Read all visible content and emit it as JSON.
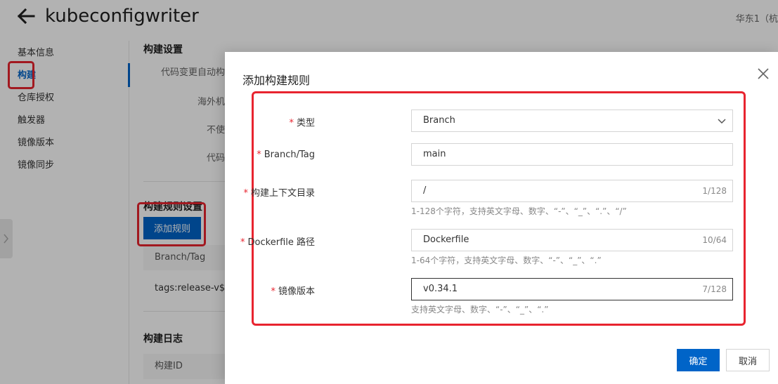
{
  "header": {
    "title": "kubeconfigwriter",
    "region": "华东1（杭"
  },
  "nav": {
    "items": [
      {
        "label": "基本信息"
      },
      {
        "label": "构建"
      },
      {
        "label": "仓库授权"
      },
      {
        "label": "触发器"
      },
      {
        "label": "镜像版本"
      },
      {
        "label": "镜像同步"
      }
    ]
  },
  "content": {
    "build_settings_title": "构建设置",
    "settings_labels": [
      "代码变更自动构",
      "海外机",
      "不使",
      "代码"
    ],
    "rules_title": "构建规则设置",
    "add_rule_label": "添加规则",
    "table_col": "Branch/Tag",
    "table_cell": "tags:release-v$ve",
    "log_title": "构建日志",
    "log_col": "构建ID"
  },
  "modal": {
    "title": "添加构建规则",
    "fields": [
      {
        "label": "类型",
        "value": "Branch",
        "counter": "",
        "help": ""
      },
      {
        "label": "Branch/Tag",
        "value": "main",
        "counter": "",
        "help": ""
      },
      {
        "label": "构建上下文目录",
        "value": "/",
        "counter": "1/128",
        "help": "1-128个字符，支持英文字母、数字、“-”、“_”、“.”、“/”"
      },
      {
        "label": "Dockerfile 路径",
        "value": "Dockerfile",
        "counter": "10/64",
        "help": "1-64个字符，支持英文字母、数字、“-”、“_”、“.”"
      },
      {
        "label": "镜像版本",
        "value": "v0.34.1",
        "counter": "7/128",
        "help": "支持英文字母、数字、“-”、“_”、“.”"
      }
    ],
    "required_mark": "*",
    "ok_label": "确定",
    "cancel_label": "取消"
  },
  "colors": {
    "accent": "#0064c8",
    "highlight": "#e8242f"
  }
}
